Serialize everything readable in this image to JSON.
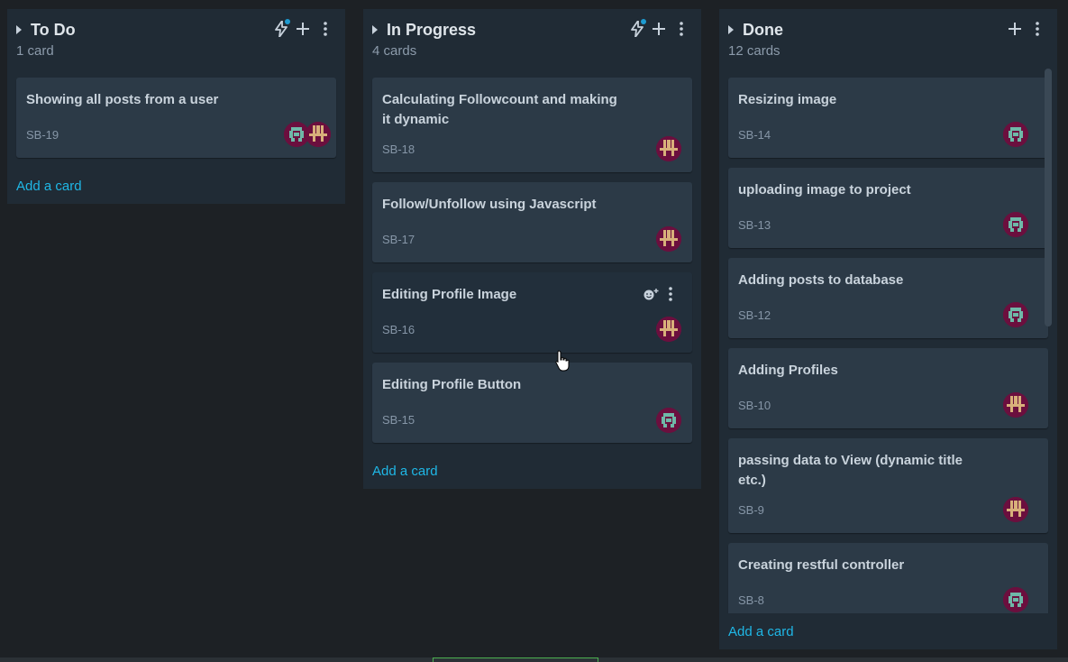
{
  "columns": {
    "todo": {
      "title": "To Do",
      "count": "1 card",
      "add_label": "Add a card",
      "cards": [
        {
          "title": "Showing all posts from a user",
          "key": "SB-19"
        }
      ]
    },
    "progress": {
      "title": "In Progress",
      "count": "4 cards",
      "add_label": "Add a card",
      "cards": [
        {
          "title": "Calculating Followcount and making it dynamic",
          "key": "SB-18"
        },
        {
          "title": "Follow/Unfollow using Javascript",
          "key": "SB-17"
        },
        {
          "title": "Editing Profile Image",
          "key": "SB-16"
        },
        {
          "title": "Editing Profile Button",
          "key": "SB-15"
        }
      ]
    },
    "done": {
      "title": "Done",
      "count": "12 cards",
      "add_label": "Add a card",
      "cards": [
        {
          "title": "Resizing image",
          "key": "SB-14"
        },
        {
          "title": "uploading image to project",
          "key": "SB-13"
        },
        {
          "title": "Adding posts to database",
          "key": "SB-12"
        },
        {
          "title": "Adding Profiles",
          "key": "SB-10"
        },
        {
          "title": "passing data to View (dynamic title etc.)",
          "key": "SB-9"
        },
        {
          "title": "Creating restful controller",
          "key": "SB-8"
        }
      ]
    }
  },
  "icons": {
    "collapse": "caret-right-icon",
    "automation": "lightning-icon",
    "add": "plus-icon",
    "more": "more-vertical-icon",
    "reaction": "emoji-add-icon",
    "cursor": "hand-pointer-icon"
  },
  "colors": {
    "background": "#1d2125",
    "column": "#202b35",
    "card": "#2c3a47",
    "link": "#1fb7e6",
    "notification_dot": "#1d9bd1",
    "avatar_bg": "#6b0f3e"
  }
}
